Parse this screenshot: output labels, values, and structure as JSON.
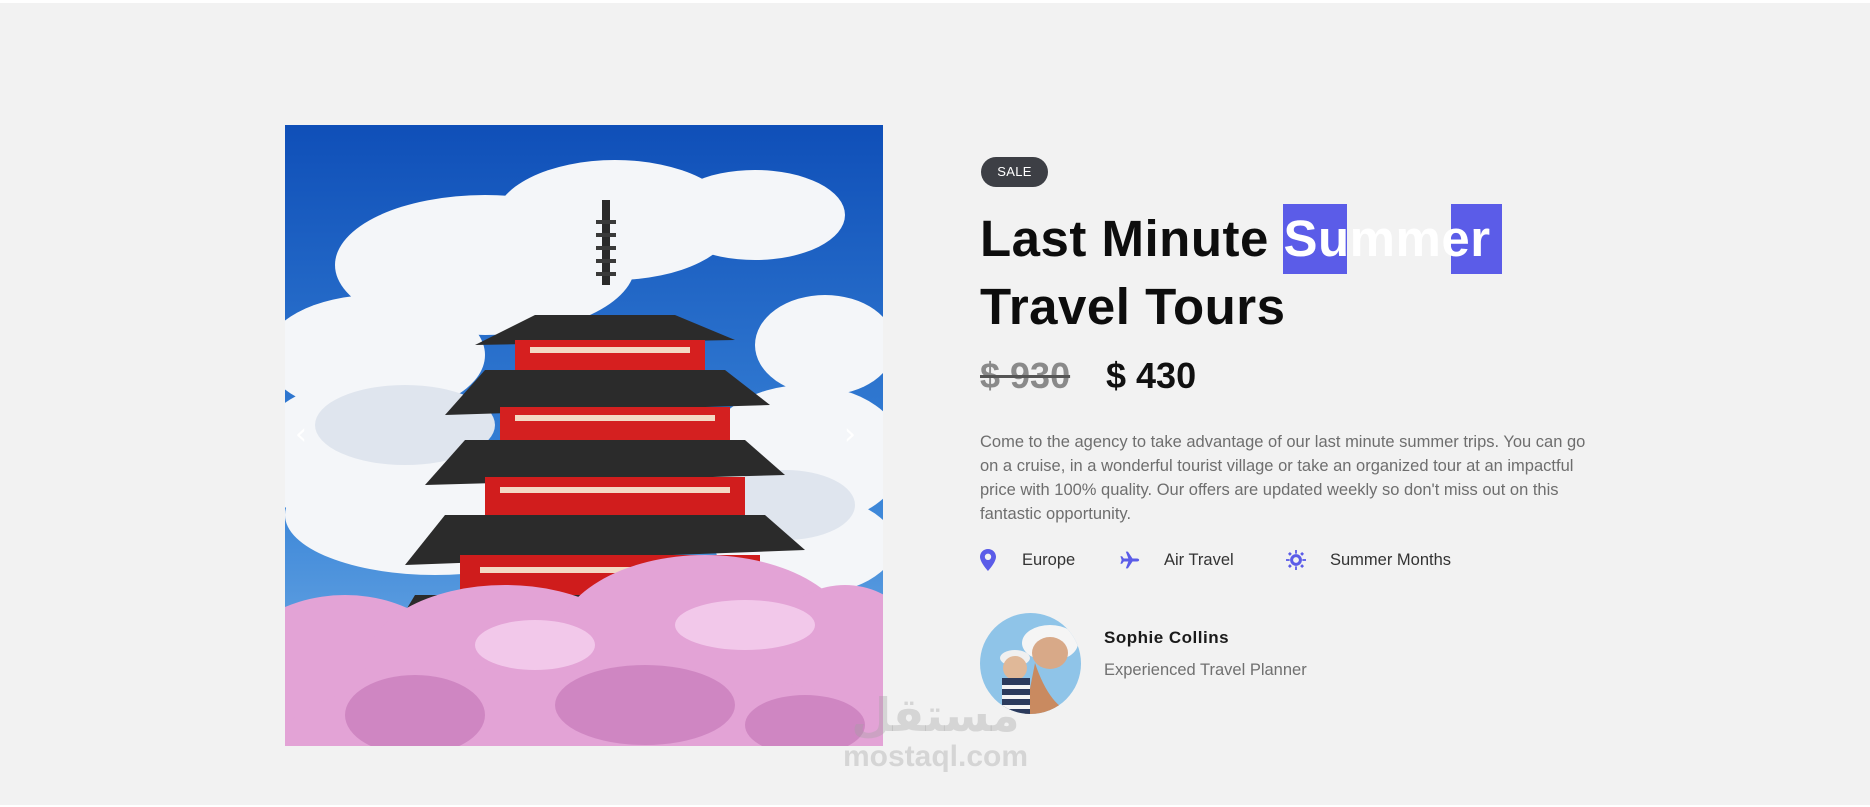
{
  "badge": "SALE",
  "title": {
    "line1_start": "Last Minute ",
    "line1_highlight": "Summer",
    "line2": "Travel Tours"
  },
  "price": {
    "old": "$ 930",
    "new": "$ 430"
  },
  "description": "Come to the agency to take advantage of our last minute summer trips. You can go on a cruise, in a wonderful tourist village or take an organized tour at an impactful price with 100% quality. Our offers are updated weekly so don't miss out on this fantastic opportunity.",
  "features": [
    {
      "icon": "map-pin-icon",
      "label": "Europe"
    },
    {
      "icon": "airplane-icon",
      "label": "Air Travel"
    },
    {
      "icon": "sun-icon",
      "label": "Summer Months"
    }
  ],
  "author": {
    "name": "Sophie Collins",
    "role": "Experienced Travel Planner"
  },
  "slider": {
    "prev": "‹",
    "next": "›",
    "image": "pagoda-cherry-blossom-photo"
  },
  "watermark": {
    "arabic": "مستقل",
    "latin": "mostaql.com"
  },
  "colors": {
    "accent": "#5b5ce8",
    "badge_bg": "#3d3f45",
    "background": "#f2f2f2"
  }
}
